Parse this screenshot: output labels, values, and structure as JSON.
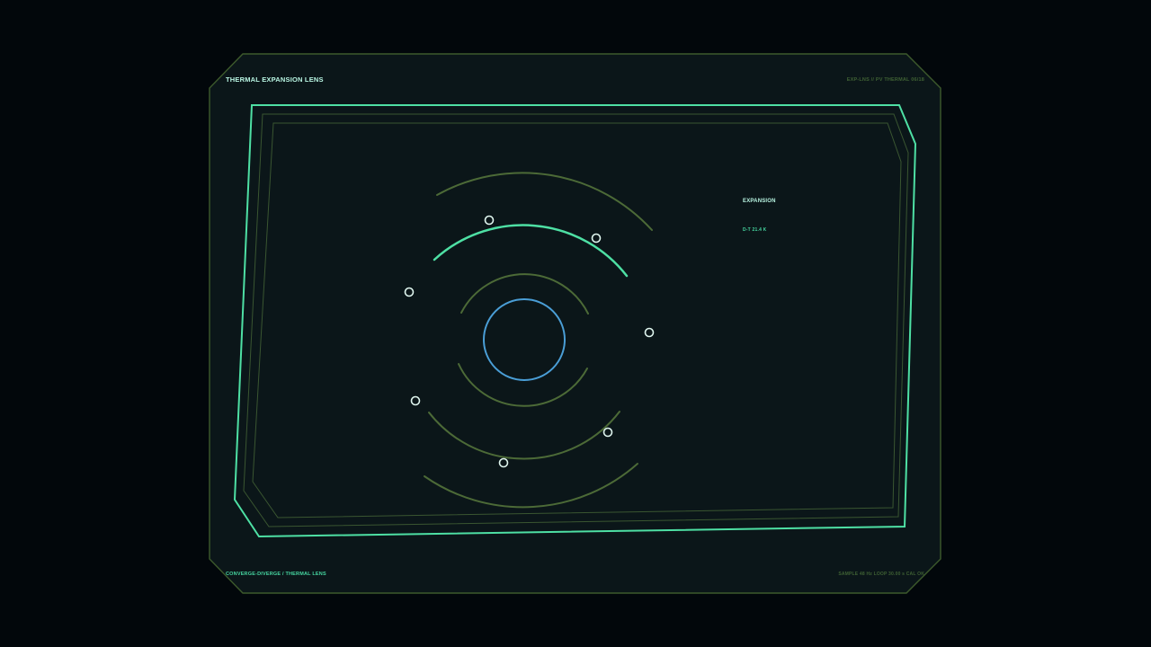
{
  "panel": {
    "title": "THERMAL EXPANSION LENS",
    "code": "EXP-LNS // PV THERMAL 06/18",
    "footer_left": "CONVERGE-DIVERGE / THERMAL LENS",
    "footer_right": "SAMPLE 48 Hz  LOOP 30.00 s  CAL OK"
  },
  "readout": {
    "label": "EXPANSION",
    "value": "D-T 21.4 K"
  },
  "colors": {
    "background": "#02070b",
    "panel": "#0b1619",
    "frame_olive": "#3d5a2c",
    "accent_mint": "#4ee0a4",
    "core_blue": "#4a9ed6",
    "marker_white": "#dff5ee"
  }
}
